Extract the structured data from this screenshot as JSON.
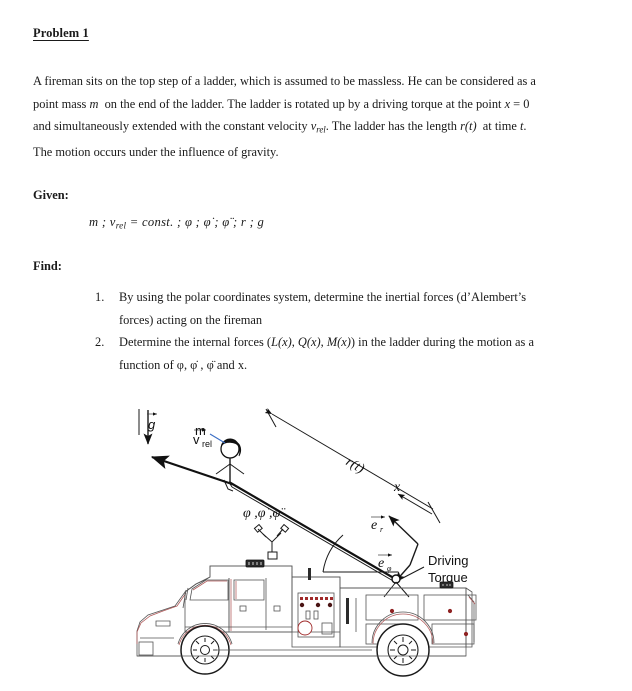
{
  "document": {
    "title": "Problem 1"
  },
  "intro": {
    "lines": [
      "A fireman sits on the top step of a ladder, which is assumed to be massless. He can be considered as a",
      "point mass m  on the end of the ladder. The ladder is rotated up by a driving torque at the point x = 0",
      "and simultaneously extended with the constant velocity vrel. The ladder has the length r(t) at time t.",
      "The motion occurs under the influence of gravity."
    ]
  },
  "given": {
    "label": "Given:",
    "formula": "m ; vrel = const. ; φ ; φ̇ ; φ̈ ; r ; g",
    "symbols": [
      "m",
      "v_rel = const.",
      "φ",
      "φ̇",
      "φ̈",
      "r",
      "g"
    ]
  },
  "find": {
    "label": "Find:",
    "items": [
      {
        "number": "1.",
        "lines": [
          "By using the polar coordinates system, determine the inertial forces (d’Alembert’s",
          "forces) acting on the fireman"
        ]
      },
      {
        "number": "2.",
        "lines": [
          "Determine the internal forces (L(x), Q(x), M(x)) in the ladder during the motion as a",
          "function of φ, φ̇ , φ̈ and x."
        ]
      }
    ]
  },
  "figure": {
    "caption": "",
    "labels": {
      "gravity": "g",
      "mass": "m",
      "v_rel": "v",
      "v_rel_sub": "rel",
      "length": "r(t)",
      "coordinate_x": "x",
      "unit_vector_r": "e",
      "unit_vector_r_sub": "r",
      "unit_vector_phi": "e",
      "unit_vector_phi_sub": "φ",
      "angles": "φ ,φ̇ ,φ̈",
      "driving_torque_line1": "Driving",
      "driving_torque_line2": "Torque"
    },
    "colors": {
      "ink": "#1a1a1a",
      "outline": "#2b2b2b",
      "truck_accent": "#b05a5a",
      "panel_red": "#a02a2a",
      "hair": "#111111",
      "pointer_blue": "#3b6fc4",
      "paper": "#ffffff"
    }
  }
}
